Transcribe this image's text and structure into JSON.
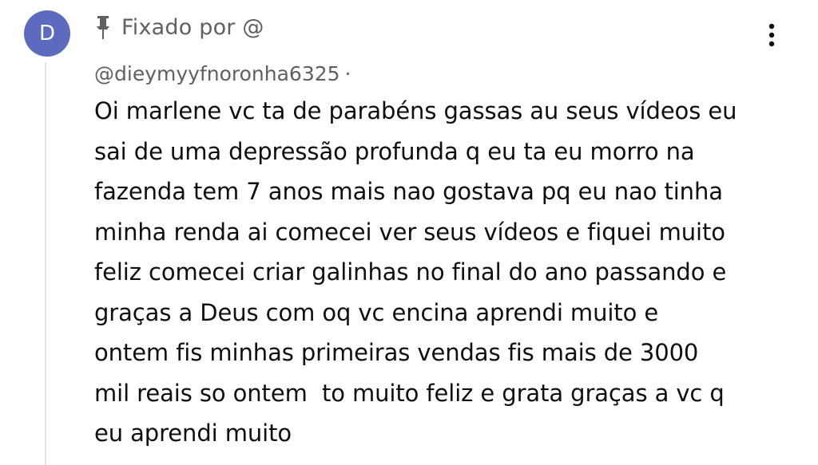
{
  "avatar": {
    "initial": "D",
    "color": "#5c6bc0"
  },
  "pinned": {
    "icon": "pin-icon",
    "label": "Fixado por @"
  },
  "menu": {
    "icon": "more-vert-icon"
  },
  "author": {
    "handle": "@dieymyyfnoronha6325",
    "separator": "·"
  },
  "comment": {
    "lines": [
      "Oi marlene vc ta de parabéns gassas au seus vídeos eu",
      "sai de uma depressão profunda q eu ta eu morro na",
      "fazenda tem 7 anos mais nao gostava pq eu nao tinha",
      "minha renda ai comecei ver seus vídeos e fiquei muito",
      "feliz comecei criar galinhas no final do ano passando e",
      "graças a Deus com oq vc encina aprendi muito e",
      "ontem fis minhas primeiras vendas fis mais de 3000",
      "mil reais so ontem  to muito feliz e grata graças a vc q",
      "eu aprendi muito"
    ]
  }
}
